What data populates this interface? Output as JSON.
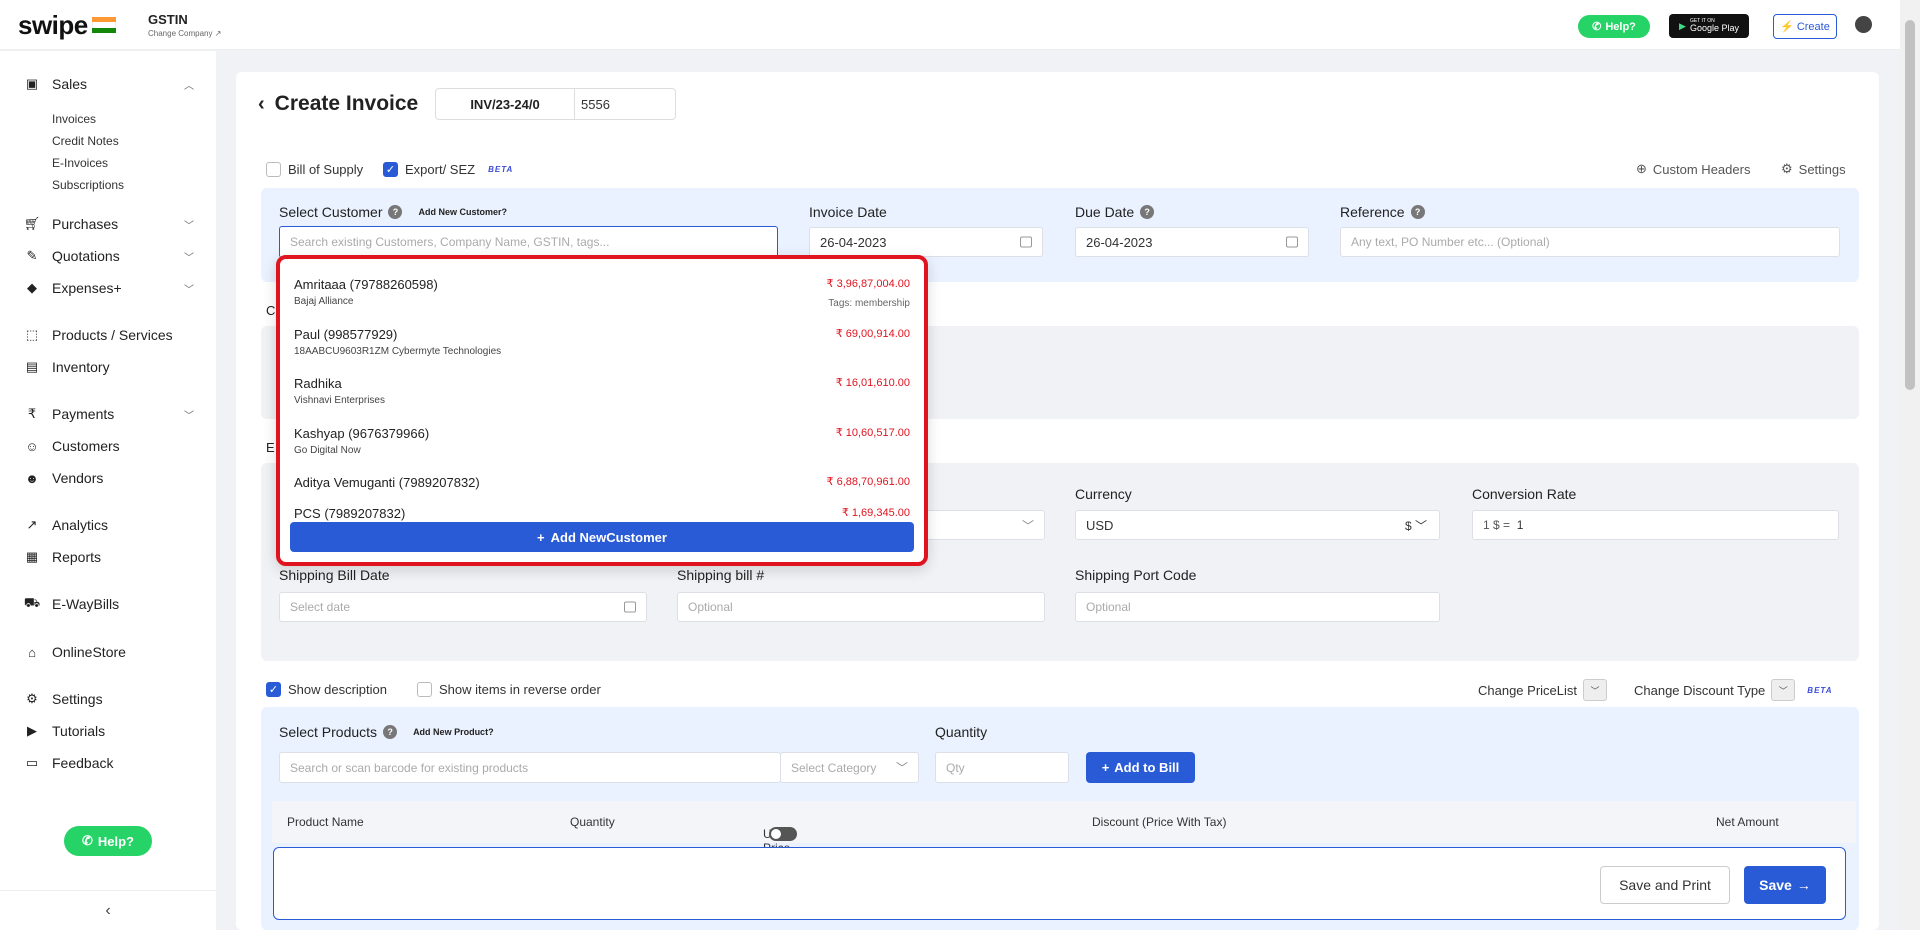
{
  "header": {
    "logo": "swipe",
    "gstin_label": "GSTIN",
    "change_company": "Change Company ↗",
    "help": "Help?",
    "google_play": "Google Play",
    "google_play_small": "GET IT ON",
    "create": "Create"
  },
  "sidebar": {
    "sales": "Sales",
    "sales_sub": [
      "Invoices",
      "Credit Notes",
      "E-Invoices",
      "Subscriptions"
    ],
    "purchases": "Purchases",
    "quotations": "Quotations",
    "expenses": "Expenses+",
    "products": "Products / Services",
    "inventory": "Inventory",
    "payments": "Payments",
    "customers": "Customers",
    "vendors": "Vendors",
    "analytics": "Analytics",
    "reports": "Reports",
    "ewaybills": "E-WayBills",
    "onlinestore": "OnlineStore",
    "settings": "Settings",
    "tutorials": "Tutorials",
    "feedback": "Feedback",
    "help": "Help?"
  },
  "page": {
    "title": "Create Invoice",
    "inv_prefix": "INV/23-24/0",
    "inv_number": "5556",
    "bill_of_supply": "Bill of Supply",
    "export_sez": "Export/ SEZ",
    "beta": "BETA",
    "custom_headers": "Custom Headers",
    "settings": "Settings"
  },
  "customer": {
    "label": "Select Customer",
    "add_new": "Add New Customer?",
    "placeholder": "Search existing Customers, Company Name, GSTIN, tags...",
    "invoice_date_label": "Invoice Date",
    "invoice_date": "26-04-2023",
    "due_date_label": "Due Date",
    "due_date": "26-04-2023",
    "reference_label": "Reference",
    "reference_placeholder": "Any text, PO Number etc... (Optional)"
  },
  "dropdown": {
    "items": [
      {
        "name": "Amritaaa (79788260598)",
        "sub": "Bajaj Alliance",
        "amount": "₹ 3,96,87,004.00",
        "tag": "Tags: membership"
      },
      {
        "name": "Paul (998577929)",
        "sub": "18AABCU9603R1ZM Cybermyte Technologies",
        "amount": "₹ 69,00,914.00",
        "tag": ""
      },
      {
        "name": "Radhika",
        "sub": "Vishnavi Enterprises",
        "amount": "₹ 16,01,610.00",
        "tag": ""
      },
      {
        "name": "Kashyap (9676379966)",
        "sub": "Go Digital Now",
        "amount": "₹ 10,60,517.00",
        "tag": ""
      },
      {
        "name": "Aditya Vemuganti (7989207832)",
        "sub": "",
        "amount": "₹ 6,88,70,961.00",
        "tag": ""
      },
      {
        "name": "PCS (7989207832)",
        "sub": "",
        "amount": "₹ 1,69,345.00",
        "tag": ""
      }
    ],
    "add_new": "Add NewCustomer"
  },
  "export": {
    "section_initial_1": "C",
    "section_initial_2": "E",
    "currency_label": "Currency",
    "currency": "USD",
    "currency_symbol": "$",
    "conversion_label": "Conversion Rate",
    "conversion_prefix": "1 $ =",
    "conversion_value": "1",
    "ship_bill_date_label": "Shipping Bill Date",
    "ship_bill_date_placeholder": "Select date",
    "ship_bill_no_label": "Shipping bill #",
    "ship_bill_no_placeholder": "Optional",
    "ship_port_label": "Shipping Port Code",
    "ship_port_placeholder": "Optional"
  },
  "options": {
    "show_description": "Show description",
    "reverse_order": "Show items in reverse order",
    "change_pricelist": "Change PriceList",
    "change_discount": "Change Discount Type",
    "beta": "BETA"
  },
  "products": {
    "label": "Select Products",
    "add_new": "Add New Product?",
    "search_placeholder": "Search or scan barcode for existing products",
    "category_placeholder": "Select Category",
    "quantity_label": "Quantity",
    "qty_placeholder": "Qty",
    "add_to_bill": "Add to Bill"
  },
  "table": {
    "columns": [
      "Product Name",
      "Quantity",
      "Unit Price",
      "Discount (Price With Tax)",
      "Net Amount"
    ]
  },
  "footer": {
    "save_print": "Save and Print",
    "save": "Save"
  },
  "colors": {
    "accent": "#2a5bd7",
    "highlight": "#e0141f",
    "whatsapp": "#25d366"
  }
}
